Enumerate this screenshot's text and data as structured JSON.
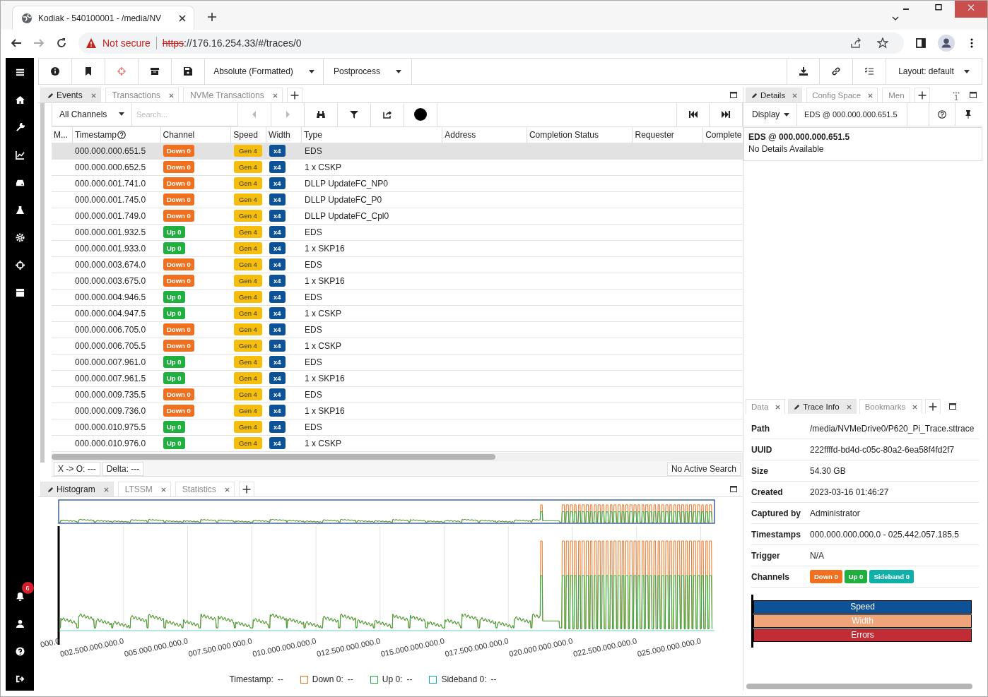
{
  "browser": {
    "tab_title": "Kodiak - 540100001 - /media/NV",
    "security": "Not secure",
    "url_scheme": "https",
    "url_rest": "://176.16.254.33/#/traces/0"
  },
  "sidebar": {
    "notification_count": "6"
  },
  "toolbar": {
    "time_format": "Absolute (Formatted)",
    "postprocess": "Postprocess",
    "layout": "Layout: default"
  },
  "main_tabs": [
    {
      "label": "Events",
      "selected": true
    },
    {
      "label": "Transactions",
      "selected": false
    },
    {
      "label": "NVMe Transactions",
      "selected": false
    }
  ],
  "events": {
    "channel_filter": "All Channels",
    "search_placeholder": "Search...",
    "columns": [
      "M...",
      "Timestamp",
      "Channel",
      "Speed",
      "Width",
      "Type",
      "Address",
      "Completion Status",
      "Requester",
      "Complete"
    ],
    "rows": [
      {
        "timestamp": "000.000.000.651.5",
        "channel": "Down 0",
        "color": "#f07020",
        "speed": "Gen 4",
        "width": "x4",
        "type": "EDS",
        "selected": true
      },
      {
        "timestamp": "000.000.000.652.5",
        "channel": "Down 0",
        "color": "#f07020",
        "speed": "Gen 4",
        "width": "x4",
        "type": "1 x CSKP",
        "selected": false
      },
      {
        "timestamp": "000.000.001.741.0",
        "channel": "Down 0",
        "color": "#f07020",
        "speed": "Gen 4",
        "width": "x4",
        "type": "DLLP UpdateFC_NP0",
        "selected": false
      },
      {
        "timestamp": "000.000.001.745.0",
        "channel": "Down 0",
        "color": "#f07020",
        "speed": "Gen 4",
        "width": "x4",
        "type": "DLLP UpdateFC_P0",
        "selected": false
      },
      {
        "timestamp": "000.000.001.749.0",
        "channel": "Down 0",
        "color": "#f07020",
        "speed": "Gen 4",
        "width": "x4",
        "type": "DLLP UpdateFC_Cpl0",
        "selected": false
      },
      {
        "timestamp": "000.000.001.932.5",
        "channel": "Up 0",
        "color": "#20b040",
        "speed": "Gen 4",
        "width": "x4",
        "type": "EDS",
        "selected": false
      },
      {
        "timestamp": "000.000.001.933.0",
        "channel": "Up 0",
        "color": "#20b040",
        "speed": "Gen 4",
        "width": "x4",
        "type": "1 x SKP16",
        "selected": false
      },
      {
        "timestamp": "000.000.003.674.0",
        "channel": "Down 0",
        "color": "#f07020",
        "speed": "Gen 4",
        "width": "x4",
        "type": "EDS",
        "selected": false
      },
      {
        "timestamp": "000.000.003.675.0",
        "channel": "Down 0",
        "color": "#f07020",
        "speed": "Gen 4",
        "width": "x4",
        "type": "1 x SKP16",
        "selected": false
      },
      {
        "timestamp": "000.000.004.946.5",
        "channel": "Up 0",
        "color": "#20b040",
        "speed": "Gen 4",
        "width": "x4",
        "type": "EDS",
        "selected": false
      },
      {
        "timestamp": "000.000.004.947.5",
        "channel": "Up 0",
        "color": "#20b040",
        "speed": "Gen 4",
        "width": "x4",
        "type": "1 x CSKP",
        "selected": false
      },
      {
        "timestamp": "000.000.006.705.0",
        "channel": "Down 0",
        "color": "#f07020",
        "speed": "Gen 4",
        "width": "x4",
        "type": "EDS",
        "selected": false
      },
      {
        "timestamp": "000.000.006.705.5",
        "channel": "Down 0",
        "color": "#f07020",
        "speed": "Gen 4",
        "width": "x4",
        "type": "1 x CSKP",
        "selected": false
      },
      {
        "timestamp": "000.000.007.961.0",
        "channel": "Up 0",
        "color": "#20b040",
        "speed": "Gen 4",
        "width": "x4",
        "type": "EDS",
        "selected": false
      },
      {
        "timestamp": "000.000.007.961.5",
        "channel": "Up 0",
        "color": "#20b040",
        "speed": "Gen 4",
        "width": "x4",
        "type": "1 x SKP16",
        "selected": false
      },
      {
        "timestamp": "000.000.009.735.5",
        "channel": "Down 0",
        "color": "#f07020",
        "speed": "Gen 4",
        "width": "x4",
        "type": "EDS",
        "selected": false
      },
      {
        "timestamp": "000.000.009.736.0",
        "channel": "Down 0",
        "color": "#f07020",
        "speed": "Gen 4",
        "width": "x4",
        "type": "1 x SKP16",
        "selected": false
      },
      {
        "timestamp": "000.000.010.975.5",
        "channel": "Up 0",
        "color": "#20b040",
        "speed": "Gen 4",
        "width": "x4",
        "type": "EDS",
        "selected": false
      },
      {
        "timestamp": "000.000.010.976.0",
        "channel": "Up 0",
        "color": "#20b040",
        "speed": "Gen 4",
        "width": "x4",
        "type": "1 x CSKP",
        "selected": false
      }
    ],
    "cursor_delta": "X -> O: ---",
    "delta": "Delta: ---",
    "search_status": "No Active Search"
  },
  "bottom_tabs": [
    {
      "label": "Histogram",
      "selected": true
    },
    {
      "label": "LTSSM",
      "selected": false
    },
    {
      "label": "Statistics",
      "selected": false
    }
  ],
  "histogram": {
    "x_tick_labels": [
      "000.0",
      "002.500.000.000.0",
      "005.000.000.000.0",
      "007.500.000.000.0",
      "010.000.000.000.0",
      "012.500.000.000.0",
      "015.000.000.000.0",
      "017.500.000.000.0",
      "020.000.000.000.0",
      "022.500.000.000.0",
      "025.000.000.000.0"
    ],
    "legend_title": "Timestamp:",
    "legend_title_value": "--",
    "legend": [
      {
        "label": "Down 0:",
        "value": "--",
        "color": "#f07020"
      },
      {
        "label": "Up 0:",
        "value": "--",
        "color": "#20b040"
      },
      {
        "label": "Sideband 0:",
        "value": "--",
        "color": "#10b0a8"
      }
    ]
  },
  "details_tabs": [
    {
      "label": "Details",
      "selected": true
    },
    {
      "label": "Config Space",
      "selected": false
    },
    {
      "label": "Men",
      "selected": false
    }
  ],
  "details_overflow_count": "1",
  "details": {
    "display": "Display",
    "event": "EDS @ 000.000.000.651.5",
    "title": "EDS @ 000.000.000.651.5",
    "message": "No Details Available"
  },
  "info_tabs": [
    {
      "label": "Data",
      "selected": false
    },
    {
      "label": "Trace Info",
      "selected": true
    },
    {
      "label": "Bookmarks",
      "selected": false
    }
  ],
  "trace_info": {
    "rows": [
      {
        "label": "Path",
        "value": "/media/NVMeDrive0/P620_Pi_Trace.sttrace"
      },
      {
        "label": "UUID",
        "value": "222ffffd-bd4d-c05c-80a2-6ea58f4fd2f7"
      },
      {
        "label": "Size",
        "value": "54.30 GB"
      },
      {
        "label": "Created",
        "value": "2023-03-16 01:46:27"
      },
      {
        "label": "Captured by",
        "value": "Administrator"
      },
      {
        "label": "Timestamps",
        "value": "000.000.000.000.0 - 025.442.057.185.5"
      },
      {
        "label": "Trigger",
        "value": "N/A"
      }
    ],
    "channels_label": "Channels",
    "channels": [
      {
        "label": "Down 0",
        "color": "#f07020"
      },
      {
        "label": "Up 0",
        "color": "#20b040"
      },
      {
        "label": "Sideband 0",
        "color": "#10b0a8"
      }
    ],
    "bars": [
      {
        "label": "Speed",
        "color": "#0d5296"
      },
      {
        "label": "Width",
        "color": "#f0a47a"
      },
      {
        "label": "Errors",
        "color": "#c22d35"
      }
    ]
  }
}
